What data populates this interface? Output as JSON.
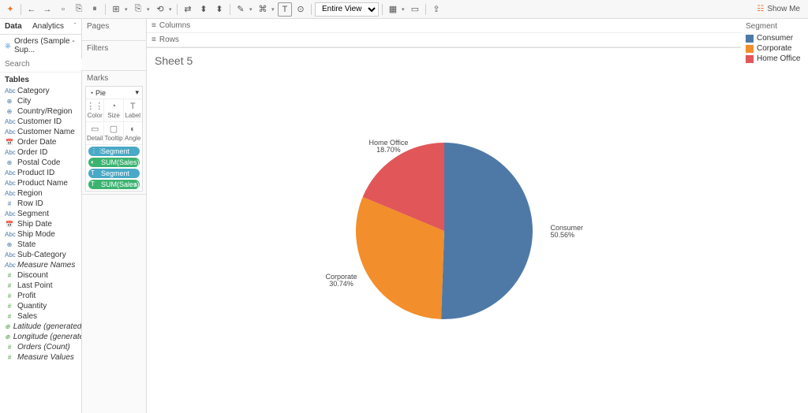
{
  "toolbar": {
    "view_select": "Entire View",
    "showme": "Show Me"
  },
  "tabs": {
    "data": "Data",
    "analytics": "Analytics"
  },
  "datasource": "Orders (Sample - Sup...",
  "search": {
    "placeholder": "Search"
  },
  "tables_label": "Tables",
  "fields": [
    {
      "type": "Abc",
      "name": "Category",
      "cls": "dim"
    },
    {
      "type": "⊕",
      "name": "City",
      "cls": "dim"
    },
    {
      "type": "⊕",
      "name": "Country/Region",
      "cls": "dim"
    },
    {
      "type": "Abc",
      "name": "Customer ID",
      "cls": "dim"
    },
    {
      "type": "Abc",
      "name": "Customer Name",
      "cls": "dim"
    },
    {
      "type": "📅",
      "name": "Order Date",
      "cls": "dim"
    },
    {
      "type": "Abc",
      "name": "Order ID",
      "cls": "dim"
    },
    {
      "type": "⊕",
      "name": "Postal Code",
      "cls": "dim"
    },
    {
      "type": "Abc",
      "name": "Product ID",
      "cls": "dim"
    },
    {
      "type": "Abc",
      "name": "Product Name",
      "cls": "dim"
    },
    {
      "type": "Abc",
      "name": "Region",
      "cls": "dim"
    },
    {
      "type": "#",
      "name": "Row ID",
      "cls": "dim"
    },
    {
      "type": "Abc",
      "name": "Segment",
      "cls": "dim"
    },
    {
      "type": "📅",
      "name": "Ship Date",
      "cls": "dim"
    },
    {
      "type": "Abc",
      "name": "Ship Mode",
      "cls": "dim"
    },
    {
      "type": "⊕",
      "name": "State",
      "cls": "dim"
    },
    {
      "type": "Abc",
      "name": "Sub-Category",
      "cls": "dim"
    },
    {
      "type": "Abc",
      "name": "Measure Names",
      "cls": "dim",
      "italic": true
    },
    {
      "type": "#",
      "name": "Discount",
      "cls": "meas"
    },
    {
      "type": "#",
      "name": "Last Point",
      "cls": "meas"
    },
    {
      "type": "#",
      "name": "Profit",
      "cls": "meas"
    },
    {
      "type": "#",
      "name": "Quantity",
      "cls": "meas"
    },
    {
      "type": "#",
      "name": "Sales",
      "cls": "meas"
    },
    {
      "type": "⊕",
      "name": "Latitude (generated)",
      "cls": "meas",
      "italic": true
    },
    {
      "type": "⊕",
      "name": "Longitude (generated)",
      "cls": "meas",
      "italic": true
    },
    {
      "type": "#",
      "name": "Orders (Count)",
      "cls": "meas",
      "italic": true
    },
    {
      "type": "#",
      "name": "Measure Values",
      "cls": "meas",
      "italic": true
    }
  ],
  "shelves": {
    "pages": "Pages",
    "filters": "Filters",
    "marks": "Marks",
    "mark_type": "Pie",
    "mark_cells": [
      {
        "ico": "⋮⋮",
        "lbl": "Color"
      },
      {
        "ico": "◔",
        "lbl": "Size"
      },
      {
        "ico": "T",
        "lbl": "Label"
      },
      {
        "ico": "▭",
        "lbl": "Detail"
      },
      {
        "ico": "▢",
        "lbl": "Tooltip"
      },
      {
        "ico": "◐",
        "lbl": "Angle"
      }
    ],
    "pills": [
      {
        "type": "dim",
        "icon": "⋮⋮",
        "text": "Segment"
      },
      {
        "type": "meas",
        "icon": "◐",
        "text": "SUM(Sales)"
      },
      {
        "type": "dim",
        "icon": "T",
        "text": "Segment"
      },
      {
        "type": "meas",
        "icon": "T",
        "text": "SUM(Sales)",
        "more": "▵"
      }
    ],
    "columns": "Columns",
    "rows": "Rows"
  },
  "sheet_title": "Sheet 5",
  "legend": {
    "title": "Segment",
    "items": [
      {
        "color": "#4e79a7",
        "label": "Consumer"
      },
      {
        "color": "#f28e2b",
        "label": "Corporate"
      },
      {
        "color": "#e15759",
        "label": "Home Office"
      }
    ]
  },
  "chart_data": {
    "type": "pie",
    "title": "Sheet 5",
    "series_name": "Segment",
    "value_name": "SUM(Sales)",
    "slices": [
      {
        "label": "Consumer",
        "percent": 50.56,
        "color": "#4e79a7"
      },
      {
        "label": "Corporate",
        "percent": 30.74,
        "color": "#f28e2b"
      },
      {
        "label": "Home Office",
        "percent": 18.7,
        "color": "#e15759"
      }
    ],
    "labels": [
      {
        "text1": "Consumer",
        "text2": "50.56%"
      },
      {
        "text1": "Corporate",
        "text2": "30.74%"
      },
      {
        "text1": "Home Office",
        "text2": "18.70%"
      }
    ]
  }
}
